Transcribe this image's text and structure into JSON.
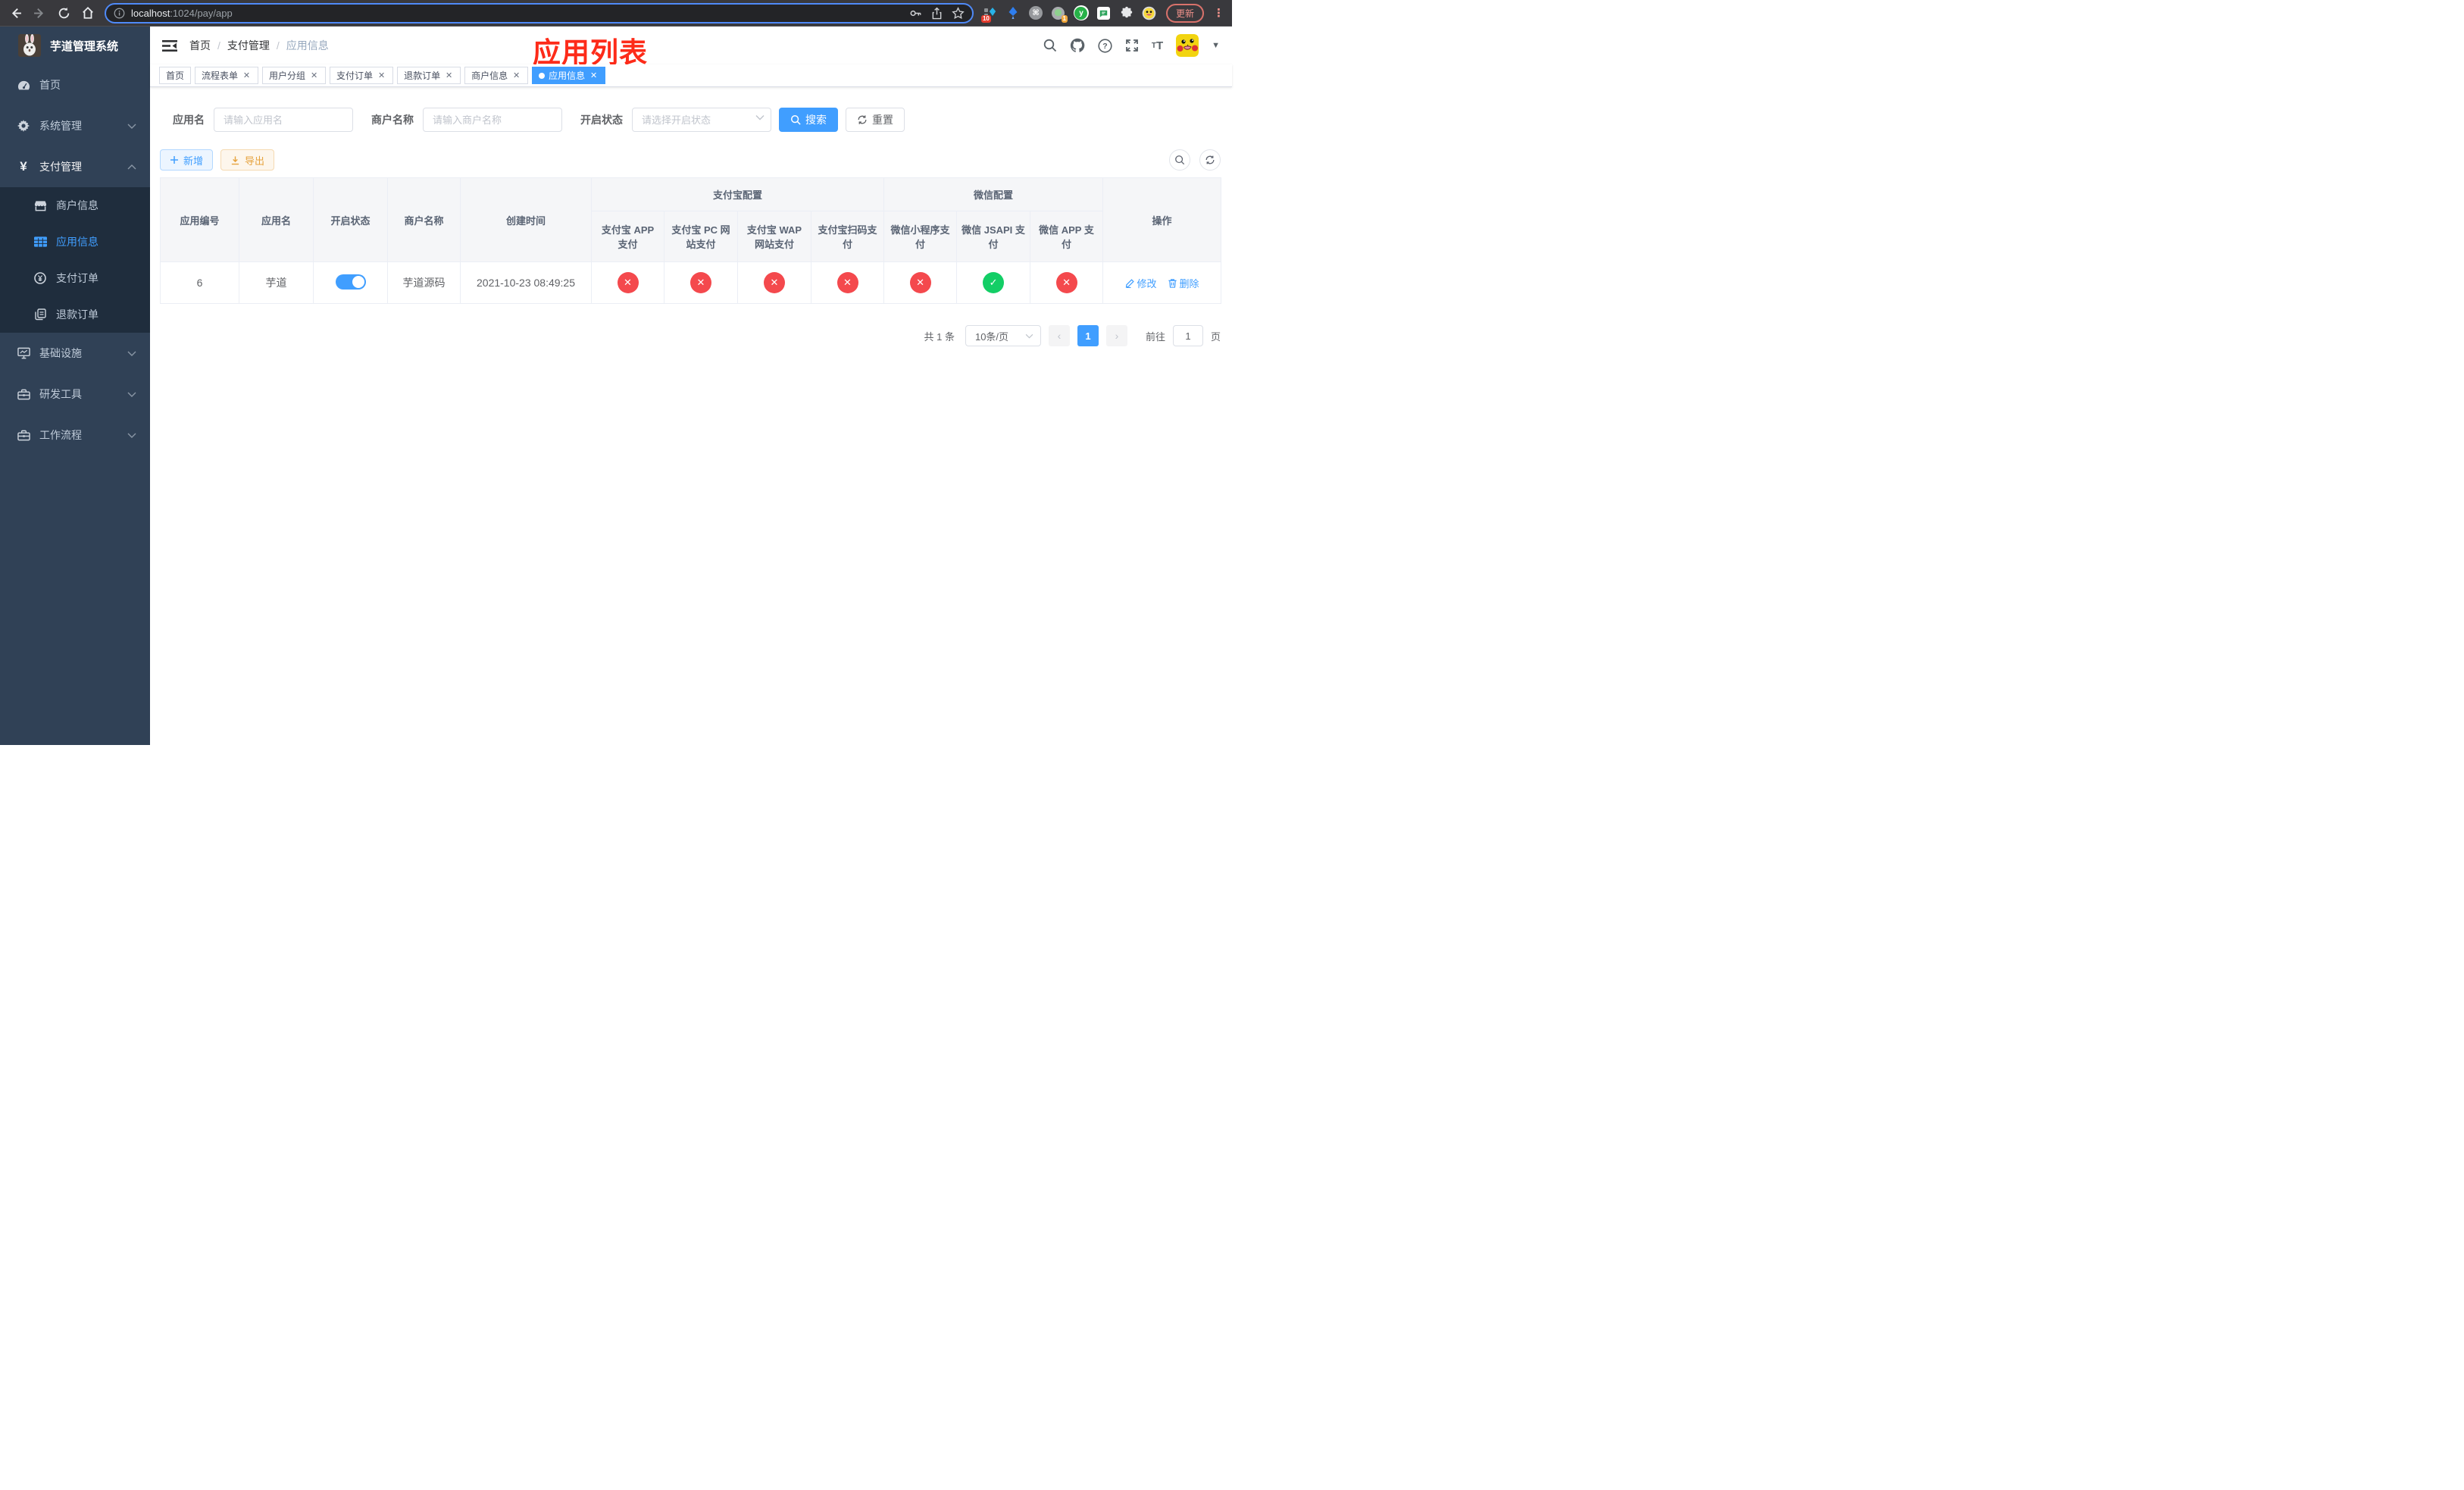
{
  "browser": {
    "url": {
      "host": "localhost",
      "rest": ":1024/pay/app"
    },
    "badges": {
      "ext1": "10",
      "ext2": "1"
    },
    "update_label": "更新"
  },
  "sidebar": {
    "title": "芋道管理系统",
    "menu": [
      {
        "label": "首页"
      },
      {
        "label": "系统管理"
      },
      {
        "label": "支付管理"
      },
      {
        "label": "基础设施"
      },
      {
        "label": "研发工具"
      },
      {
        "label": "工作流程"
      }
    ],
    "submenu": [
      {
        "label": "商户信息"
      },
      {
        "label": "应用信息",
        "active": true
      },
      {
        "label": "支付订单"
      },
      {
        "label": "退款订单"
      }
    ]
  },
  "navbar": {
    "breadcrumb": [
      "首页",
      "支付管理",
      "应用信息"
    ],
    "annotation": "应用列表"
  },
  "tags": [
    {
      "label": "首页"
    },
    {
      "label": "流程表单"
    },
    {
      "label": "用户分组"
    },
    {
      "label": "支付订单"
    },
    {
      "label": "退款订单"
    },
    {
      "label": "商户信息"
    },
    {
      "label": "应用信息"
    }
  ],
  "filters": {
    "app_name": {
      "label": "应用名",
      "placeholder": "请输入应用名",
      "value": ""
    },
    "merchant_name": {
      "label": "商户名称",
      "placeholder": "请输入商户名称",
      "value": ""
    },
    "status": {
      "label": "开启状态",
      "placeholder": "请选择开启状态",
      "value": ""
    },
    "search_label": "搜索",
    "reset_label": "重置"
  },
  "toolbar": {
    "add_label": "新增",
    "export_label": "导出"
  },
  "table": {
    "columns": [
      "应用编号",
      "应用名",
      "开启状态",
      "商户名称",
      "创建时间"
    ],
    "groups": [
      {
        "label": "支付宝配置",
        "children": [
          "支付宝 APP 支付",
          "支付宝 PC 网站支付",
          "支付宝 WAP 网站支付",
          "支付宝扫码支付"
        ]
      },
      {
        "label": "微信配置",
        "children": [
          "微信小程序支付",
          "微信 JSAPI 支付",
          "微信 APP 支付"
        ]
      }
    ],
    "actions_label": "操作",
    "row": {
      "id": "6",
      "name": "芋道",
      "enabled": true,
      "merchant": "芋道源码",
      "created": "2021-10-23 08:49:25",
      "statuses": [
        false,
        false,
        false,
        false,
        false,
        true,
        false
      ],
      "edit_label": "修改",
      "delete_label": "删除"
    }
  },
  "pagination": {
    "total": "共 1 条",
    "page_size": "10条/页",
    "current_page": "1",
    "goto_label": "前往",
    "goto_value": "1",
    "unit_label": "页"
  },
  "colors": {
    "accent": "#409eff",
    "success": "#13ce66",
    "danger": "#f4494d",
    "warning": "#e6a23c",
    "annotation": "#fd2b19",
    "sidebar": "#304156",
    "submenu": "#1f2d3d"
  }
}
